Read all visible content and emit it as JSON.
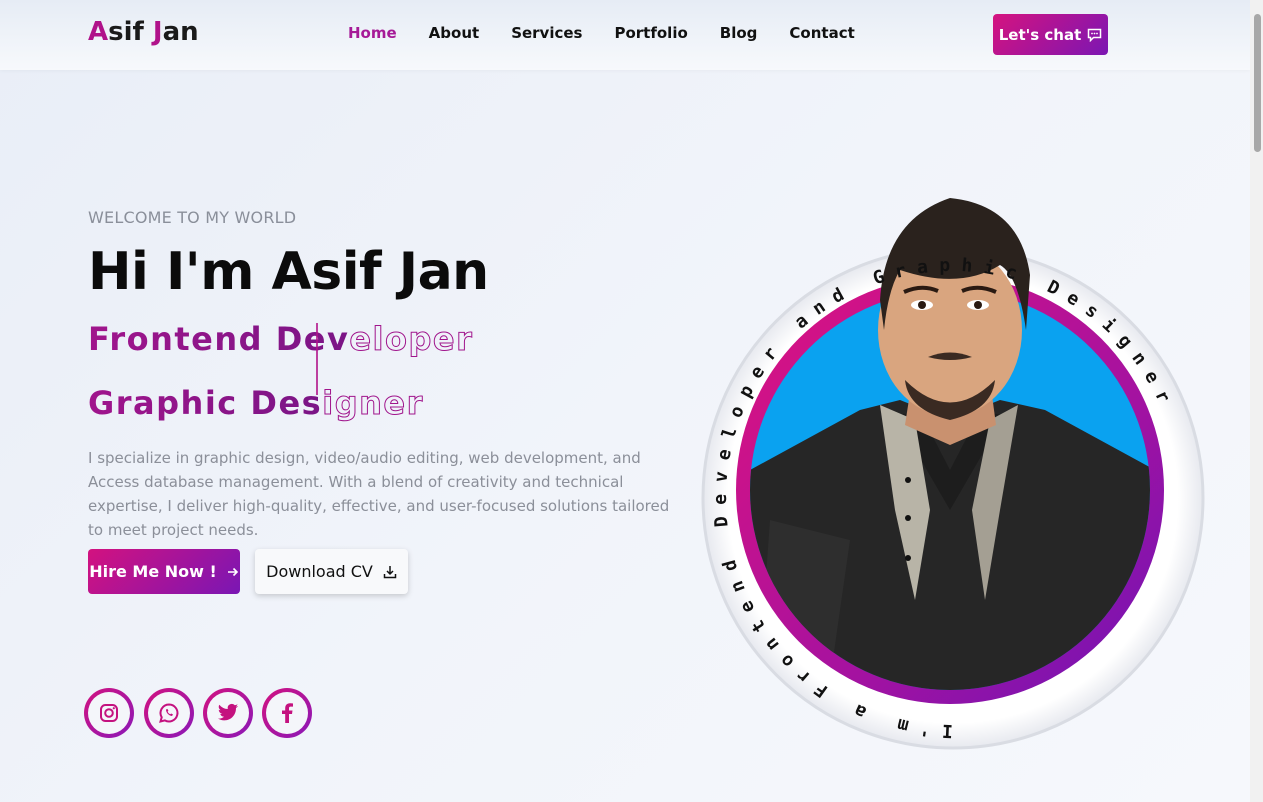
{
  "nav": {
    "logo_first": "A",
    "logo_rest1": "sif ",
    "logo_j": "J",
    "logo_rest2": "an",
    "items": [
      "Home",
      "About",
      "Services",
      "Portfolio",
      "Blog",
      "Contact"
    ],
    "active": "Home",
    "chat_label": "Let's chat",
    "chat_icon": "chat-bubble-icon"
  },
  "hero": {
    "welcome": "WELCOME TO MY WORLD",
    "greeting": "Hi I'm Asif Jan",
    "role1_fill": "Frontend Dev",
    "role1_outline": "eloper",
    "role2_fill": "Graphic Des",
    "role2_outline": "igner",
    "description": "I specialize in graphic design, video/audio editing, web development, and Access database management. With a blend of creativity and technical expertise, I deliver high-quality, effective, and user-focused solutions tailored to meet project needs.",
    "hire_label": "Hire Me Now !",
    "cv_label": "Download CV"
  },
  "social": [
    "instagram-icon",
    "whatsapp-icon",
    "twitter-icon",
    "facebook-icon"
  ],
  "ring_text": "I'm a Frontend Developer and Graphic Designer",
  "colors": {
    "accent": "#b0128a",
    "gradient_start": "#d5137f",
    "gradient_end": "#7b16b3",
    "photo_bg": "#0aa2f0"
  }
}
